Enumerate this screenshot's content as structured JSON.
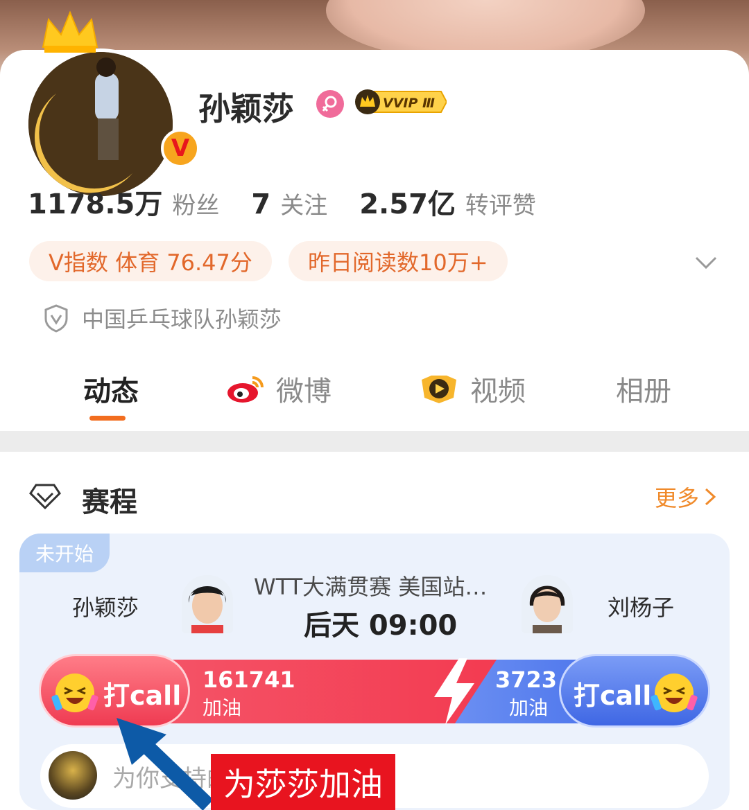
{
  "profile": {
    "name": "孙颖莎",
    "vip_badge": "VVIP Ⅲ",
    "verified_badge": "V"
  },
  "stats": [
    {
      "value": "1178.5万",
      "label": "粉丝"
    },
    {
      "value": "7",
      "label": "关注"
    },
    {
      "value": "2.57亿",
      "label": "转评赞"
    }
  ],
  "tags": [
    "V指数 体育 76.47分",
    "昨日阅读数10万+"
  ],
  "certification": "中国乒乓球队孙颖莎",
  "tabs": [
    "动态",
    "微博",
    "视频",
    "相册"
  ],
  "schedule": {
    "title": "赛程",
    "more": "更多",
    "match": {
      "status": "未开始",
      "player_left": "孙颖莎",
      "player_right": "刘杨子",
      "event": "WTT大满贯赛 美国站…",
      "time": "后天 09:00",
      "left_count": "161741",
      "right_count": "3723",
      "cheer_label": "加油",
      "call_button": "打call"
    },
    "comment_placeholder": "为你支持的选手加油吧~"
  },
  "overlay_caption": "为莎莎加油",
  "colors": {
    "accent_orange": "#f26d1f",
    "red_team": "#f33b51",
    "blue_team": "#3c67e8",
    "annotation_red": "#e8141f",
    "annotation_arrow": "#0d5aa7"
  }
}
